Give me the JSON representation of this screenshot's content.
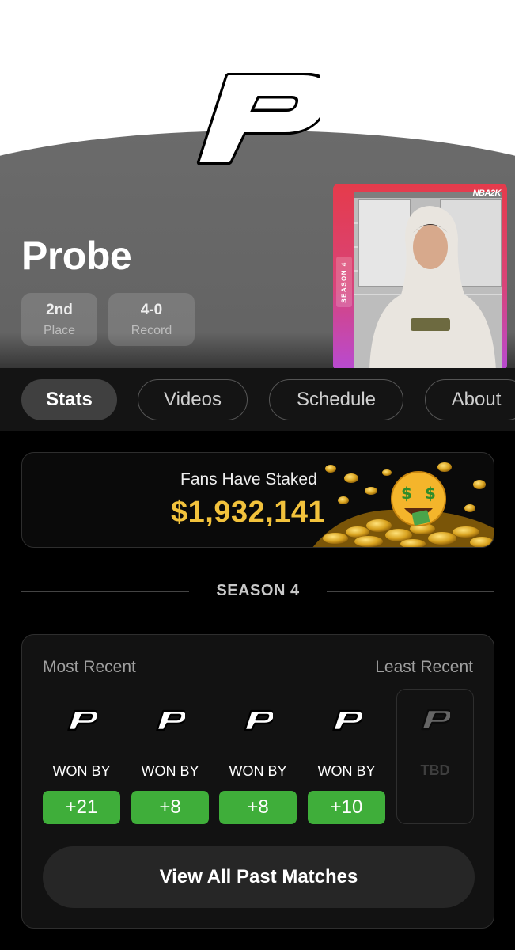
{
  "player": {
    "name": "Probe"
  },
  "stats": {
    "place": {
      "value": "2nd",
      "label": "Place"
    },
    "record": {
      "value": "4-0",
      "label": "Record"
    }
  },
  "card": {
    "badge": "NBA2K",
    "season": "SEASON 4"
  },
  "tabs": [
    "Stats",
    "Videos",
    "Schedule",
    "About"
  ],
  "staked": {
    "title": "Fans Have Staked",
    "amount": "$1,932,141"
  },
  "season_label": "SEASON 4",
  "matches": {
    "most_recent_label": "Most Recent",
    "least_recent_label": "Least Recent",
    "results": [
      {
        "label": "WON BY",
        "margin": "+21"
      },
      {
        "label": "WON BY",
        "margin": "+8"
      },
      {
        "label": "WON BY",
        "margin": "+8"
      },
      {
        "label": "WON BY",
        "margin": "+10"
      }
    ],
    "upcoming": {
      "label": "TBD"
    },
    "view_all_label": "View All Past Matches"
  },
  "colors": {
    "win_green": "#3fae3a",
    "stake_gold": "#f2c23c",
    "card_red": "#e53b4b",
    "card_purple": "#b84ad2"
  },
  "icons": [
    "brand-p-logo-icon",
    "money-face-emoji-icon",
    "coins-pile-icon"
  ]
}
